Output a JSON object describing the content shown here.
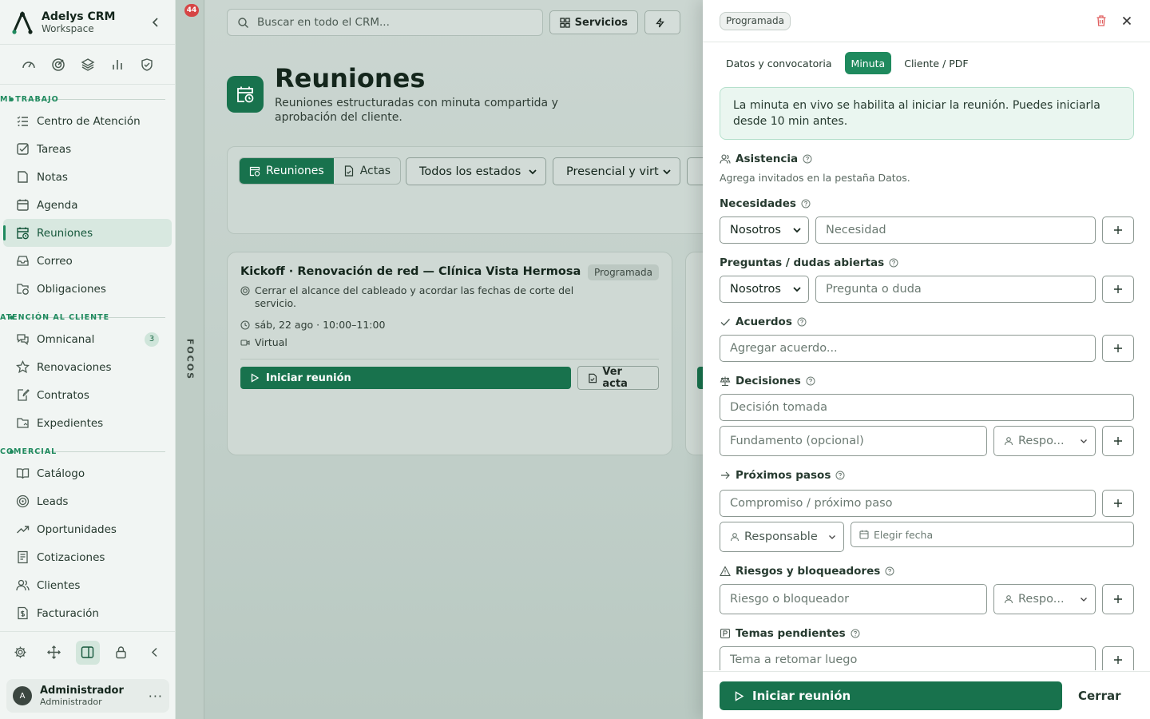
{
  "brand": {
    "name": "Adelys CRM",
    "sub": "Workspace"
  },
  "sidebar": {
    "sections": [
      {
        "label": "MI TRABAJO",
        "items": [
          {
            "label": "Centro de Atención",
            "icon": "list-check-icon"
          },
          {
            "label": "Tareas",
            "icon": "checkbox-icon"
          },
          {
            "label": "Notas",
            "icon": "note-icon"
          },
          {
            "label": "Agenda",
            "icon": "calendar-icon"
          },
          {
            "label": "Reuniones",
            "icon": "calendar-clock-icon",
            "active": true
          },
          {
            "label": "Correo",
            "icon": "inbox-icon"
          },
          {
            "label": "Obligaciones",
            "icon": "folder-clock-icon"
          }
        ]
      },
      {
        "label": "ATENCIÓN AL CLIENTE",
        "items": [
          {
            "label": "Omnicanal",
            "icon": "chat-icon",
            "badge": "3"
          },
          {
            "label": "Renovaciones",
            "icon": "star-icon"
          },
          {
            "label": "Contratos",
            "icon": "document-pen-icon"
          },
          {
            "label": "Expedientes",
            "icon": "folder-icon"
          }
        ]
      },
      {
        "label": "COMERCIAL",
        "items": [
          {
            "label": "Catálogo",
            "icon": "book-open-icon"
          },
          {
            "label": "Leads",
            "icon": "target-icon"
          },
          {
            "label": "Oportunidades",
            "icon": "trend-up-icon"
          },
          {
            "label": "Cotizaciones",
            "icon": "receipt-icon"
          },
          {
            "label": "Clientes",
            "icon": "users-icon"
          },
          {
            "label": "Facturación",
            "icon": "invoice-dollar-icon"
          }
        ]
      }
    ]
  },
  "user": {
    "initial": "A",
    "name": "Administrador",
    "role": "Administrador"
  },
  "focos": {
    "label": "FOCOS",
    "badge": "44"
  },
  "topbar": {
    "search_placeholder": "Buscar en todo el CRM...",
    "servicios": "Servicios"
  },
  "page": {
    "title": "Reuniones",
    "subtitle": "Reuniones estructuradas con minuta compartida y aprobación del cliente."
  },
  "filters": {
    "seg": [
      "Reuniones",
      "Actas"
    ],
    "estado": "Todos los estados",
    "modalidad": "Presencial y virtual"
  },
  "card": {
    "title": "Kickoff · Renovación de red — Clínica Vista Hermosa",
    "status": "Programada",
    "goal": "Cerrar el alcance del cableado y acordar las fechas de corte del servicio.",
    "when": "sáb, 22 ago · 10:00–11:00",
    "mode": "Virtual",
    "start": "Iniciar reunión",
    "acta": "Ver acta"
  },
  "drawer": {
    "status": "Programada",
    "tabs": [
      "Datos y convocatoria",
      "Minuta",
      "Cliente / PDF"
    ],
    "active_tab": "Minuta",
    "info": "La minuta en vivo se habilita al iniciar la reunión. Puedes iniciarla desde 10 min antes.",
    "asistencia": {
      "label": "Asistencia",
      "hint": "Agrega invitados en la pestaña Datos."
    },
    "necesidades": {
      "label": "Necesidades",
      "owner": "Nosotros",
      "placeholder": "Necesidad"
    },
    "preguntas": {
      "label": "Preguntas / dudas abiertas",
      "owner": "Nosotros",
      "placeholder": "Pregunta o duda"
    },
    "acuerdos": {
      "label": "Acuerdos",
      "placeholder": "Agregar acuerdo..."
    },
    "decisiones": {
      "label": "Decisiones",
      "placeholder": "Decisión tomada",
      "fundamento": "Fundamento (opcional)",
      "resp": "Respo..."
    },
    "pasos": {
      "label": "Próximos pasos",
      "placeholder": "Compromiso / próximo paso",
      "resp": "Responsable",
      "fecha": "Elegir fecha"
    },
    "riesgos": {
      "label": "Riesgos y bloqueadores",
      "placeholder": "Riesgo o bloqueador",
      "resp": "Respo..."
    },
    "temas": {
      "label": "Temas pendientes",
      "placeholder": "Tema a retomar luego"
    },
    "start": "Iniciar reunión",
    "close": "Cerrar"
  },
  "colors": {
    "primary": "#18724d",
    "accent": "#1f8a5e",
    "danger": "#d64545"
  }
}
